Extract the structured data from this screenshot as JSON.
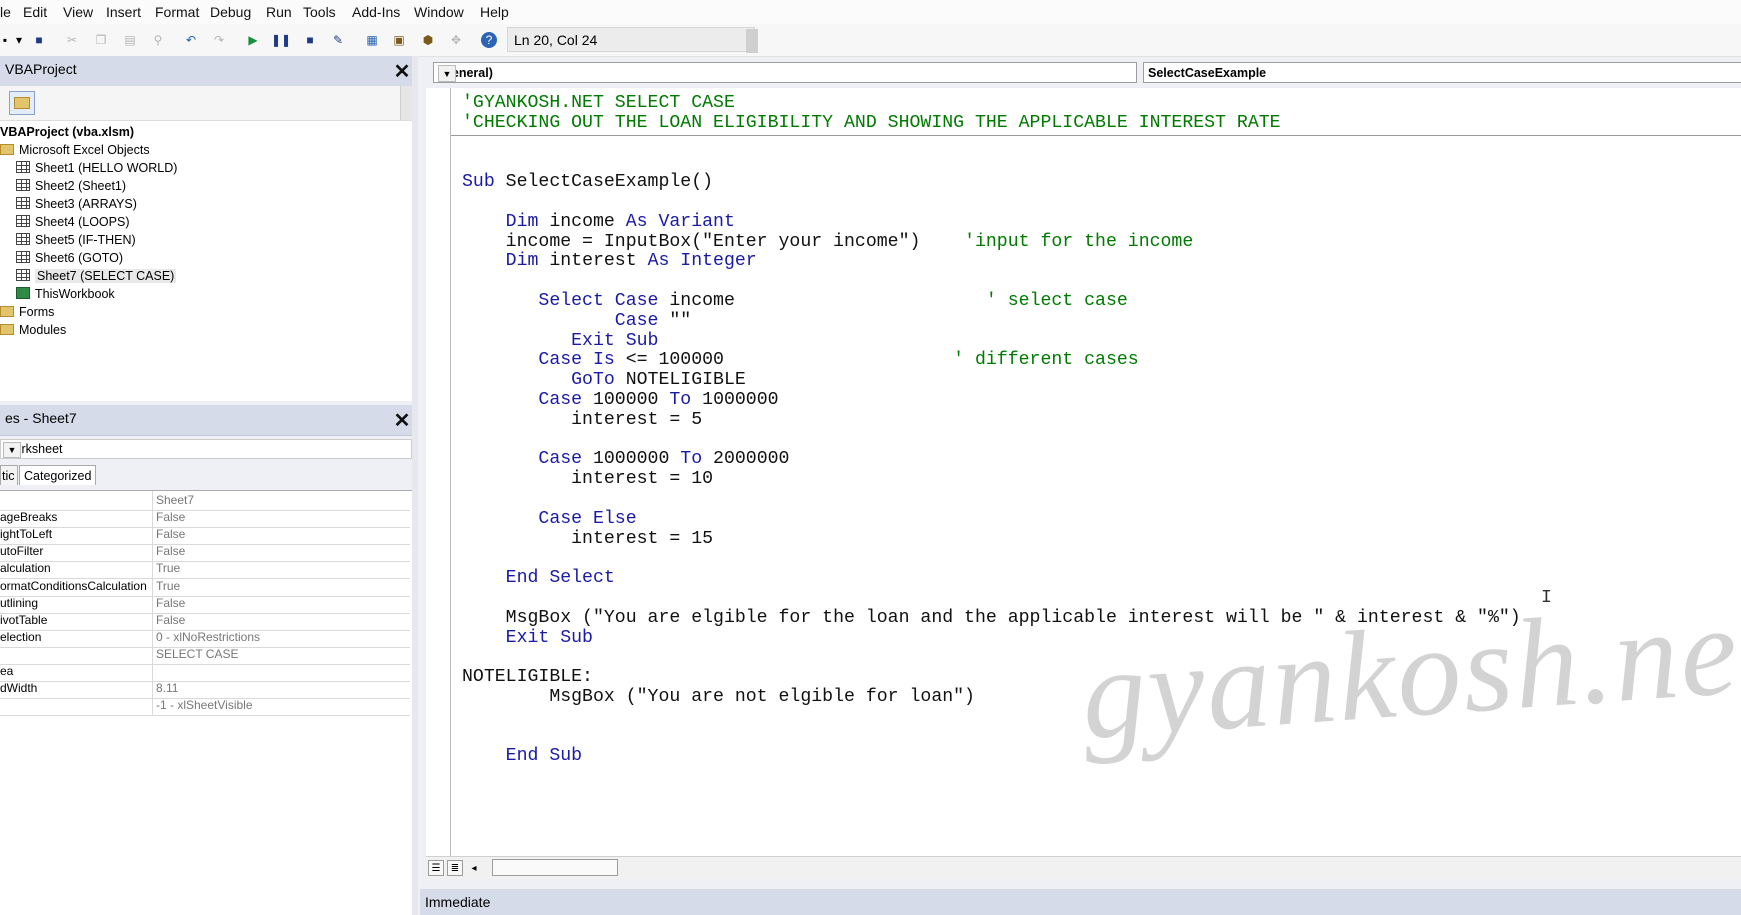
{
  "menu": [
    "le",
    "Edit",
    "View",
    "Insert",
    "Format",
    "Debug",
    "Run",
    "Tools",
    "Add-Ins",
    "Window",
    "Help"
  ],
  "toolbar": {
    "position_label": "Ln 20, Col 24",
    "icons": [
      "menu-dropdown-icon",
      "save-icon",
      "cut-icon",
      "copy-icon",
      "paste-icon",
      "find-icon",
      "undo-icon",
      "redo-icon",
      "run-icon",
      "break-icon",
      "reset-icon",
      "design-mode-icon",
      "project-explorer-icon",
      "properties-icon",
      "object-browser-icon",
      "toolbox-icon",
      "help-icon"
    ]
  },
  "project": {
    "title": "VBAProject",
    "root": "VBAProject (vba.xlsm)",
    "group": "Microsoft Excel Objects",
    "sheets": [
      "Sheet1 (HELLO WORLD)",
      "Sheet2 (Sheet1)",
      "Sheet3 (ARRAYS)",
      "Sheet4 (LOOPS)",
      "Sheet5 (IF-THEN)",
      "Sheet6 (GOTO)",
      "Sheet7 (SELECT CASE)"
    ],
    "workbook": "ThisWorkbook",
    "folders": [
      "Forms",
      "Modules"
    ]
  },
  "properties": {
    "title": "es - Sheet7",
    "object_select": "Worksheet",
    "tabs": [
      "tic",
      "Categorized"
    ],
    "rows": [
      {
        "name": "",
        "value": "Sheet7"
      },
      {
        "name": "ageBreaks",
        "value": "False"
      },
      {
        "name": "ightToLeft",
        "value": "False"
      },
      {
        "name": "utoFilter",
        "value": "False"
      },
      {
        "name": "alculation",
        "value": "True"
      },
      {
        "name": "ormatConditionsCalculation",
        "value": "True"
      },
      {
        "name": "utlining",
        "value": "False"
      },
      {
        "name": "ivotTable",
        "value": "False"
      },
      {
        "name": "election",
        "value": "0 - xlNoRestrictions"
      },
      {
        "name": "",
        "value": "SELECT CASE"
      },
      {
        "name": "ea",
        "value": ""
      },
      {
        "name": "dWidth",
        "value": "8.11"
      },
      {
        "name": "",
        "value": "-1 - xlSheetVisible"
      }
    ]
  },
  "code_window": {
    "object_combo": "(General)",
    "procedure_combo": "SelectCaseExample",
    "lines": [
      {
        "i": 0,
        "parts": [
          [
            "cm",
            "'GYANKOSH.NET SELECT CASE"
          ]
        ]
      },
      {
        "i": 1,
        "parts": [
          [
            "cm",
            "'CHECKING OUT THE LOAN ELIGIBILITY AND SHOWING THE APPLICABLE INTEREST RATE"
          ]
        ]
      },
      {
        "i": 4,
        "parts": [
          [
            "kw",
            "Sub"
          ],
          [
            "nm",
            " SelectCaseExample()"
          ]
        ]
      },
      {
        "i": 6,
        "parts": [
          [
            "kw",
            "    Dim"
          ],
          [
            "nm",
            " income "
          ],
          [
            "kw",
            "As Variant"
          ]
        ]
      },
      {
        "i": 7,
        "parts": [
          [
            "nm",
            "    income = InputBox(\"Enter your income\")    "
          ],
          [
            "cm",
            "'input for the income"
          ]
        ]
      },
      {
        "i": 8,
        "parts": [
          [
            "kw",
            "    Dim"
          ],
          [
            "nm",
            " interest "
          ],
          [
            "kw",
            "As Integer"
          ]
        ]
      },
      {
        "i": 10,
        "parts": [
          [
            "kw",
            "       Select Case"
          ],
          [
            "nm",
            " income                       "
          ],
          [
            "cm",
            "' select case"
          ]
        ]
      },
      {
        "i": 11,
        "parts": [
          [
            "kw",
            "              Case"
          ],
          [
            "nm",
            " \"\""
          ]
        ]
      },
      {
        "i": 12,
        "parts": [
          [
            "kw",
            "          Exit Sub"
          ]
        ]
      },
      {
        "i": 13,
        "parts": [
          [
            "kw",
            "       Case Is"
          ],
          [
            "nm",
            " <= 100000                     "
          ],
          [
            "cm",
            "' different cases"
          ]
        ]
      },
      {
        "i": 14,
        "parts": [
          [
            "kw",
            "          GoTo"
          ],
          [
            "nm",
            " NOTELIGIBLE"
          ]
        ]
      },
      {
        "i": 15,
        "parts": [
          [
            "kw",
            "       Case"
          ],
          [
            "nm",
            " 100000 "
          ],
          [
            "kw",
            "To"
          ],
          [
            "nm",
            " 1000000"
          ]
        ]
      },
      {
        "i": 16,
        "parts": [
          [
            "nm",
            "          interest = 5"
          ]
        ]
      },
      {
        "i": 18,
        "parts": [
          [
            "kw",
            "       Case"
          ],
          [
            "nm",
            " 1000000 "
          ],
          [
            "kw",
            "To"
          ],
          [
            "nm",
            " 2000000"
          ]
        ]
      },
      {
        "i": 19,
        "parts": [
          [
            "nm",
            "          interest = 10"
          ]
        ]
      },
      {
        "i": 21,
        "parts": [
          [
            "kw",
            "       Case Else"
          ]
        ]
      },
      {
        "i": 22,
        "parts": [
          [
            "nm",
            "          interest = 15"
          ]
        ]
      },
      {
        "i": 24,
        "parts": [
          [
            "kw",
            "    End Select"
          ]
        ]
      },
      {
        "i": 26,
        "parts": [
          [
            "nm",
            "    MsgBox (\"You are elgible for the loan and the applicable interest will be \" & interest & \"%\")"
          ]
        ]
      },
      {
        "i": 27,
        "parts": [
          [
            "kw",
            "    Exit Sub"
          ]
        ]
      },
      {
        "i": 29,
        "parts": [
          [
            "nm",
            "NOTELIGIBLE:"
          ]
        ]
      },
      {
        "i": 30,
        "parts": [
          [
            "nm",
            "        MsgBox (\"You are not elgible for loan\")"
          ]
        ]
      },
      {
        "i": 33,
        "parts": [
          [
            "kw",
            "    End Sub"
          ]
        ]
      }
    ],
    "watermark": "gyankosh.net",
    "caret": "I"
  },
  "immediate": {
    "title": "Immediate"
  }
}
